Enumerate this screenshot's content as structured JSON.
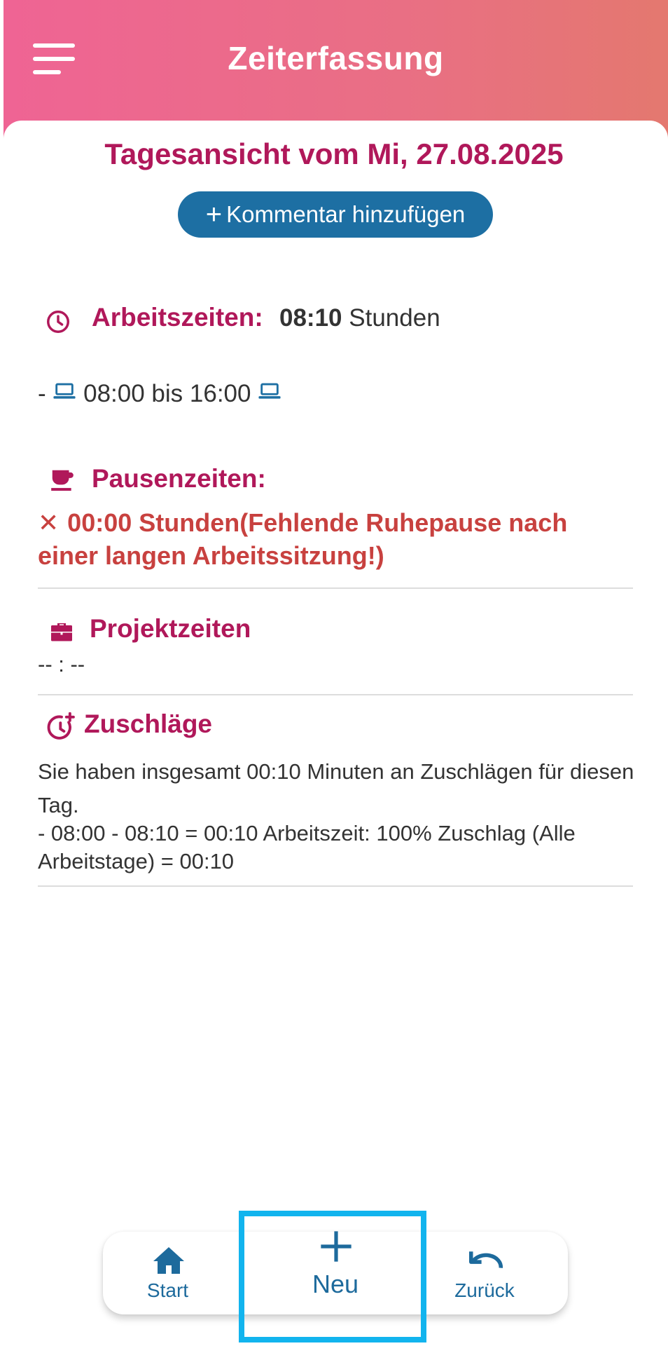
{
  "header": {
    "title": "Zeiterfassung",
    "menu_icon": "hamburger-menu-icon"
  },
  "day": {
    "title": "Tagesansicht vom Mi, 27.08.2025",
    "comment_button": "Kommentar hinzufügen"
  },
  "work": {
    "label": "Arbeitszeiten:",
    "hours": "08:10",
    "unit": "Stunden",
    "entry_prefix": "-",
    "entry_range": "08:00 bis 16:00",
    "icon": "clock-icon",
    "entry_icon": "laptop-icon"
  },
  "breaks": {
    "label": "Pausenzeiten:",
    "warning_line1": "00:00 Stunden(Fehlende Ruhepause nach",
    "warning_line2": "einer langen Arbeitssitzung!)",
    "icon": "coffee-cup-icon"
  },
  "projects": {
    "label": "Projektzeiten",
    "value": "-- : --",
    "icon": "briefcase-icon"
  },
  "surcharges": {
    "label": "Zuschläge",
    "line1": "Sie haben insgesamt 00:10 Minuten an Zuschlägen für diesen Tag.",
    "line2": "- 08:00 - 08:10 = 00:10 Arbeitszeit: 100% Zuschlag (Alle Arbeitstage) = 00:10",
    "icon": "clock-plus-icon"
  },
  "bottom_nav": {
    "start": "Start",
    "new": "Neu",
    "back": "Zurück"
  },
  "colors": {
    "header_gradient_start": "#ef6494",
    "header_gradient_end": "#e4786f",
    "accent_magenta": "#b0185a",
    "button_blue": "#1d6fa3",
    "warning_red": "#c8413f",
    "highlight_box": "#12b4ee"
  }
}
